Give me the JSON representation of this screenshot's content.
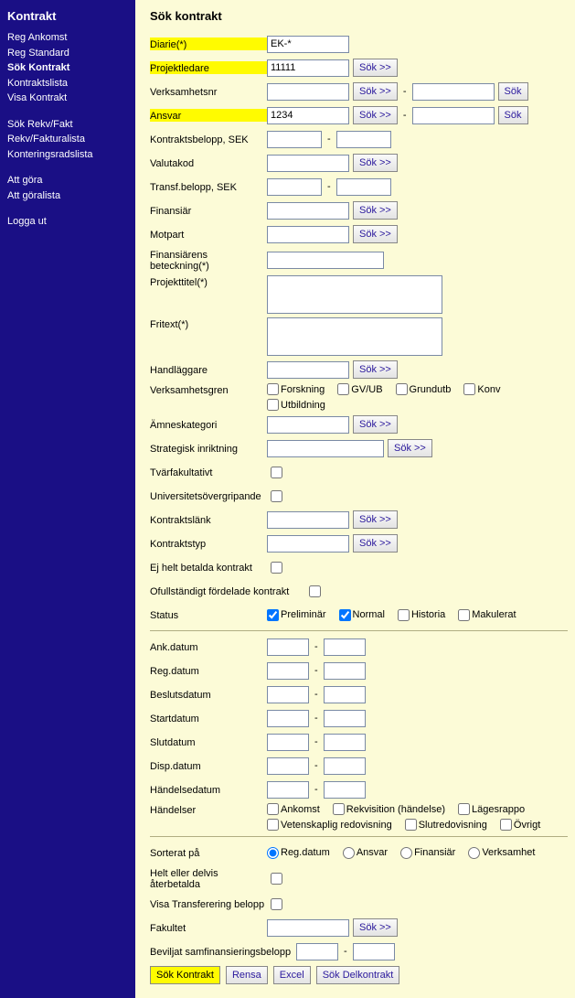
{
  "sidebar": {
    "title": "Kontrakt",
    "groups": [
      [
        "Reg Ankomst",
        "Reg Standard",
        "Sök Kontrakt",
        "Kontraktslista",
        "Visa Kontrakt"
      ],
      [
        "Sök Rekv/Fakt",
        "Rekv/Fakturalista",
        "Konteringsradslista"
      ],
      [
        "Att göra",
        "Att göralista"
      ],
      [
        "Logga ut"
      ]
    ],
    "active": "Sök Kontrakt"
  },
  "page": {
    "title": "Sök kontrakt"
  },
  "btn": {
    "sok": "Sök >>",
    "sokShort": "Sök",
    "sokKontrakt": "Sök Kontrakt",
    "rensa": "Rensa",
    "excel": "Excel",
    "sokDelkontrakt": "Sök Delkontrakt"
  },
  "labels": {
    "diarie": "Diarie(*)",
    "projektledare": "Projektledare",
    "verksamhetsnr": "Verksamhetsnr",
    "ansvar": "Ansvar",
    "kontraktsbelopp": "Kontraktsbelopp, SEK",
    "valutakod": "Valutakod",
    "transfbelopp": "Transf.belopp, SEK",
    "finansiar": "Finansiär",
    "motpart": "Motpart",
    "finansiarensbet": "Finansiärens beteckning(*)",
    "projekttitel": "Projekttitel(*)",
    "fritext": "Fritext(*)",
    "handlaggare": "Handläggare",
    "verksamhetsgren": "Verksamhetsgren",
    "amneskategori": "Ämneskategori",
    "strategisk": "Strategisk inriktning",
    "tvarfakultativt": "Tvärfakultativt",
    "universitetsovergripande": "Universitetsövergripande",
    "kontraktslank": "Kontraktslänk",
    "kontraktstyp": "Kontraktstyp",
    "ejhelt": "Ej helt betalda kontrakt",
    "ofullstandigt": "Ofullständigt fördelade kontrakt",
    "status": "Status",
    "ankdatum": "Ank.datum",
    "regdatum": "Reg.datum",
    "beslutsdatum": "Beslutsdatum",
    "startdatum": "Startdatum",
    "slutdatum": "Slutdatum",
    "dispdatum": "Disp.datum",
    "handelsedatum": "Händelsedatum",
    "handelser": "Händelser",
    "sorteratpa": "Sorterat på",
    "heltelller": "Helt eller delvis återbetalda",
    "visatransferering": "Visa Transferering belopp",
    "fakultet": "Fakultet",
    "beviljat": "Beviljat samfinansieringsbelopp"
  },
  "values": {
    "diarie": "EK-*",
    "projektledare": "11111",
    "ansvar": "1234"
  },
  "verksamhetsgren": {
    "forskning": "Forskning",
    "gvub": "GV/UB",
    "grundutb": "Grundutb",
    "konv": "Konv",
    "utbildning": "Utbildning"
  },
  "status": {
    "preliminar": "Preliminär",
    "normal": "Normal",
    "historia": "Historia",
    "makulerat": "Makulerat"
  },
  "handelser": {
    "ankomst": "Ankomst",
    "rekvisition": "Rekvisition (händelse)",
    "lagesrapport": "Lägesrappo",
    "vetenskaplig": "Vetenskaplig redovisning",
    "slutredovisning": "Slutredovisning",
    "ovrigt": "Övrigt"
  },
  "sort": {
    "regdatum": "Reg.datum",
    "ansvar": "Ansvar",
    "finansiar": "Finansiär",
    "verksamhet": "Verksamhet"
  }
}
